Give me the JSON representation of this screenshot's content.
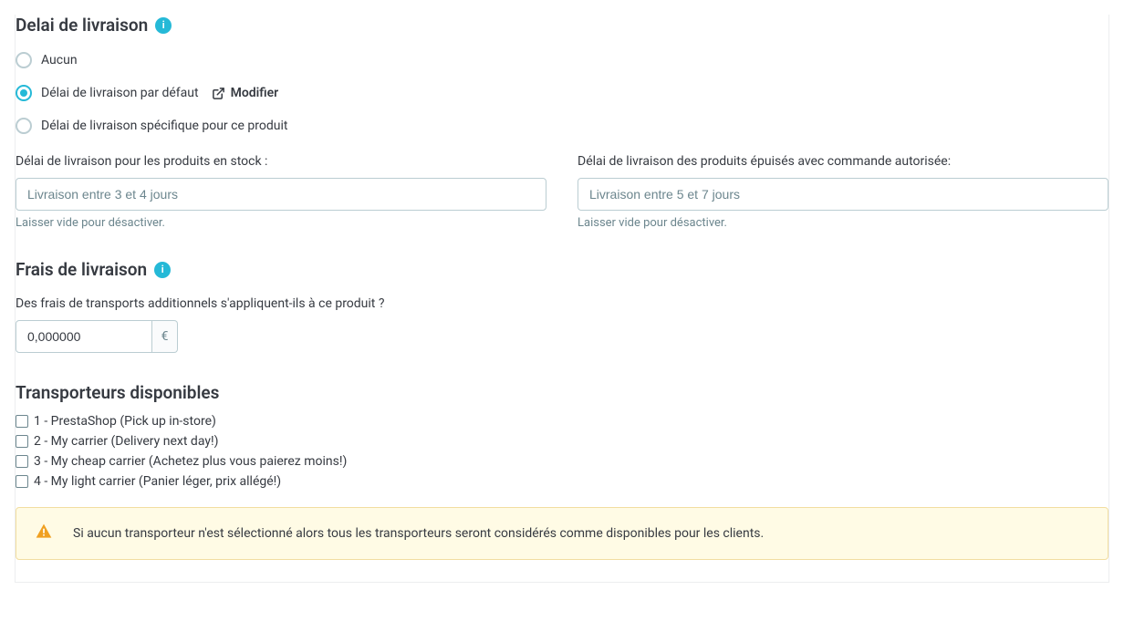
{
  "delivery_time": {
    "title": "Delai de livraison",
    "options": {
      "none": "Aucun",
      "default": "Délai de livraison par défaut",
      "specific": "Délai de livraison spécifique pour ce produit"
    },
    "modify_label": "Modifier",
    "in_stock": {
      "label": "Délai de livraison pour les produits en stock :",
      "placeholder": "Livraison entre 3 et 4 jours",
      "helper": "Laisser vide pour désactiver."
    },
    "out_of_stock": {
      "label": "Délai de livraison des produits épuisés avec commande autorisée:",
      "placeholder": "Livraison entre 5 et 7 jours",
      "helper": "Laisser vide pour désactiver."
    }
  },
  "shipping_fees": {
    "title": "Frais de livraison",
    "question": "Des frais de transports additionnels s'appliquent-ils à ce produit ?",
    "value": "0,000000",
    "currency": "€"
  },
  "carriers": {
    "title": "Transporteurs disponibles",
    "items": [
      "1 - PrestaShop (Pick up in-store)",
      "2 - My carrier (Delivery next day!)",
      "3 - My cheap carrier (Achetez plus vous paierez moins!)",
      "4 - My light carrier (Panier léger, prix allégé!)"
    ],
    "alert": "Si aucun transporteur n'est sélectionné alors tous les transporteurs seront considérés comme disponibles pour les clients."
  }
}
